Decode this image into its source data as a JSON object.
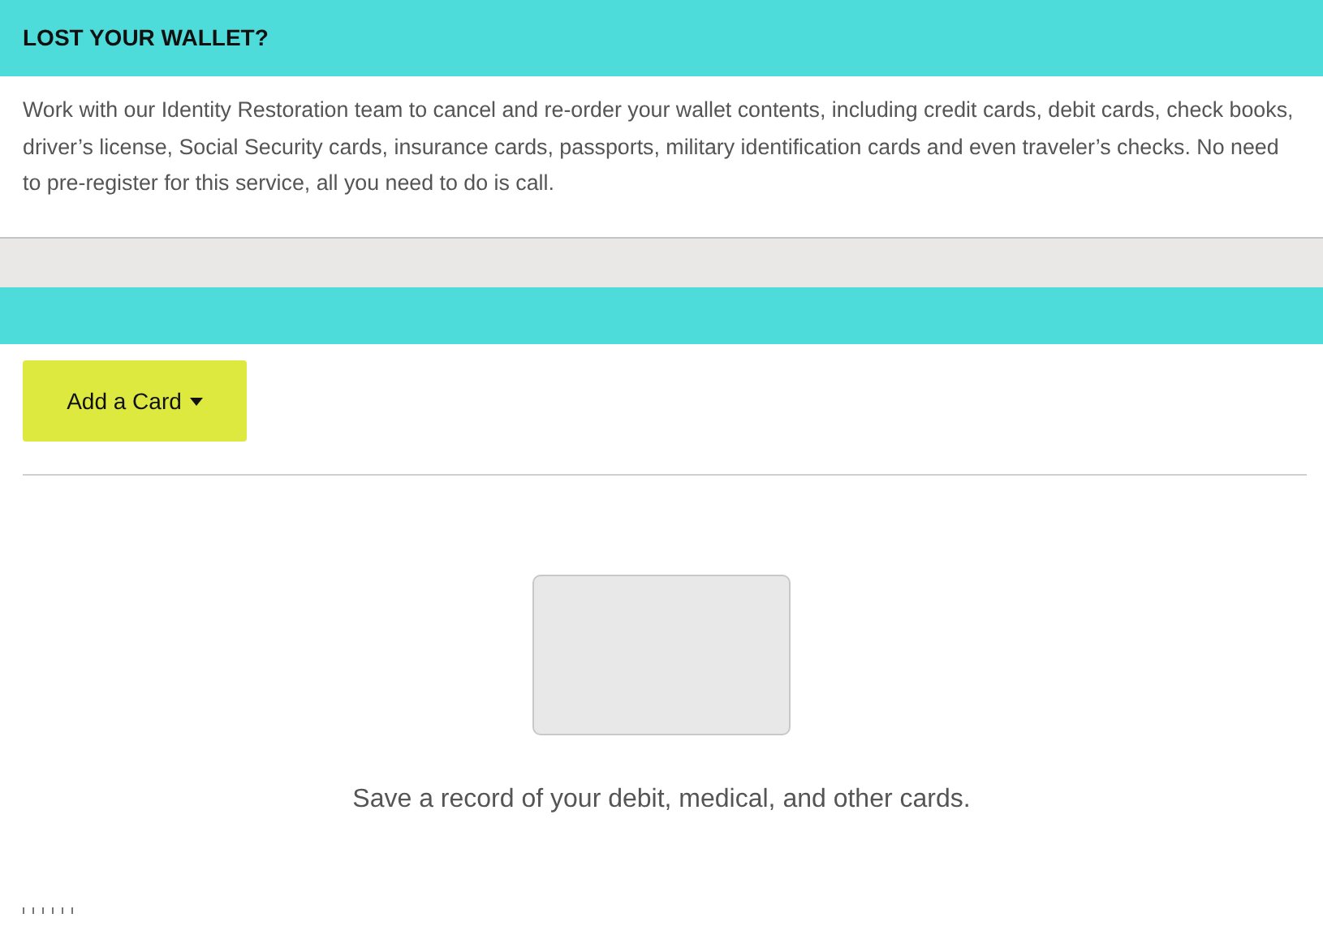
{
  "header": {
    "title": "LOST YOUR WALLET?"
  },
  "description": "Work with our Identity Restoration team to cancel and re-order your wallet contents, including credit cards, debit cards, check books, driver’s license, Social Security cards, insurance cards, passports, military identification cards and even traveler’s checks. No need to pre-register for this service, all you need to do is call.",
  "add_card_button": {
    "label": "Add a Card"
  },
  "empty_state": {
    "message": "Save a record of your debit, medical, and other cards."
  }
}
